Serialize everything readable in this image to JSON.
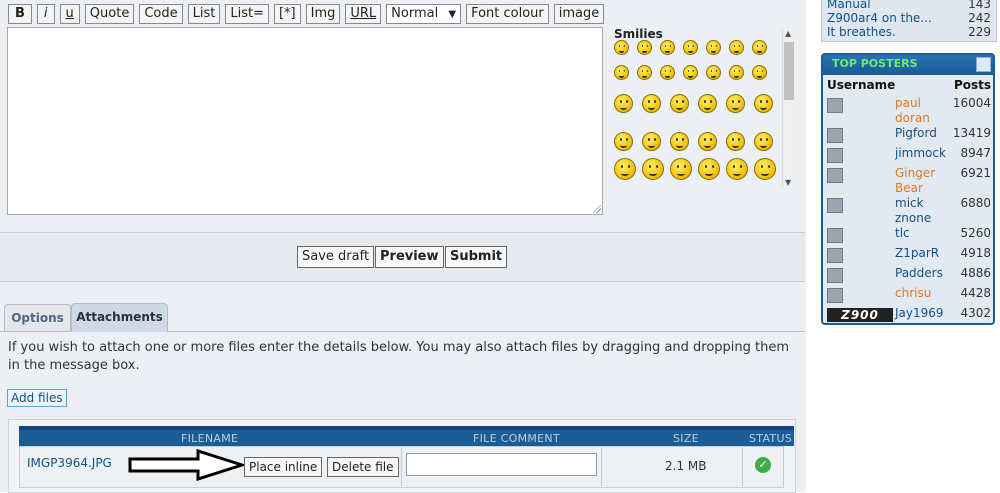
{
  "toolbar": {
    "bold": "B",
    "italic": "i",
    "underline": "u",
    "quote": "Quote",
    "code": "Code",
    "list": "List",
    "list_eq": "List=",
    "list_item": "[*]",
    "img": "Img",
    "url": "URL",
    "font_size": "Normal",
    "font_size_arrow": "▼",
    "font_colour": "Font colour",
    "image": "image"
  },
  "smilies": {
    "title": "Smilies",
    "count": 33
  },
  "buttons": {
    "save_draft": "Save draft",
    "preview": "Preview",
    "submit": "Submit"
  },
  "tabs": [
    {
      "label": "Options",
      "active": false
    },
    {
      "label": "Attachments",
      "active": true
    }
  ],
  "attachments": {
    "info": "If you wish to attach one or more files enter the details below. You may also attach files by dragging and dropping them in the message box.",
    "add_files": "Add files",
    "headers": {
      "filename": "FILENAME",
      "comment": "FILE COMMENT",
      "size": "SIZE",
      "status": "STATUS"
    },
    "file": {
      "name": "IMGP3964.JPG",
      "place_inline": "Place inline",
      "delete": "Delete file",
      "comment": "",
      "size": "2.1 MB",
      "status_icon": "check-icon",
      "status_color": "#3fae49"
    }
  },
  "sidebar": {
    "topics": [
      {
        "title": "Manual",
        "count": "143"
      },
      {
        "title": "Z900ar4 on the...",
        "count": "242"
      },
      {
        "title": "It breathes.",
        "count": "229"
      }
    ],
    "top_posters": {
      "title": "TOP POSTERS",
      "col_username": "Username",
      "col_posts": "Posts",
      "accent": "#1d5d96",
      "rows": [
        {
          "name": "paul doran",
          "posts": "16004",
          "color": "orange"
        },
        {
          "name": "Pigford",
          "posts": "13419",
          "color": "blue"
        },
        {
          "name": "jimmock",
          "posts": "8947",
          "color": "blue"
        },
        {
          "name": "Ginger Bear",
          "posts": "6921",
          "color": "orange"
        },
        {
          "name": "mick znone",
          "posts": "6880",
          "color": "blue"
        },
        {
          "name": "tlc",
          "posts": "5260",
          "color": "blue"
        },
        {
          "name": "Z1parR",
          "posts": "4918",
          "color": "blue"
        },
        {
          "name": "Padders",
          "posts": "4886",
          "color": "blue"
        },
        {
          "name": "chrisu",
          "posts": "4428",
          "color": "orange"
        },
        {
          "name": "Jay1969",
          "posts": "4302",
          "color": "blue"
        }
      ],
      "logo_text": "Z900"
    }
  }
}
